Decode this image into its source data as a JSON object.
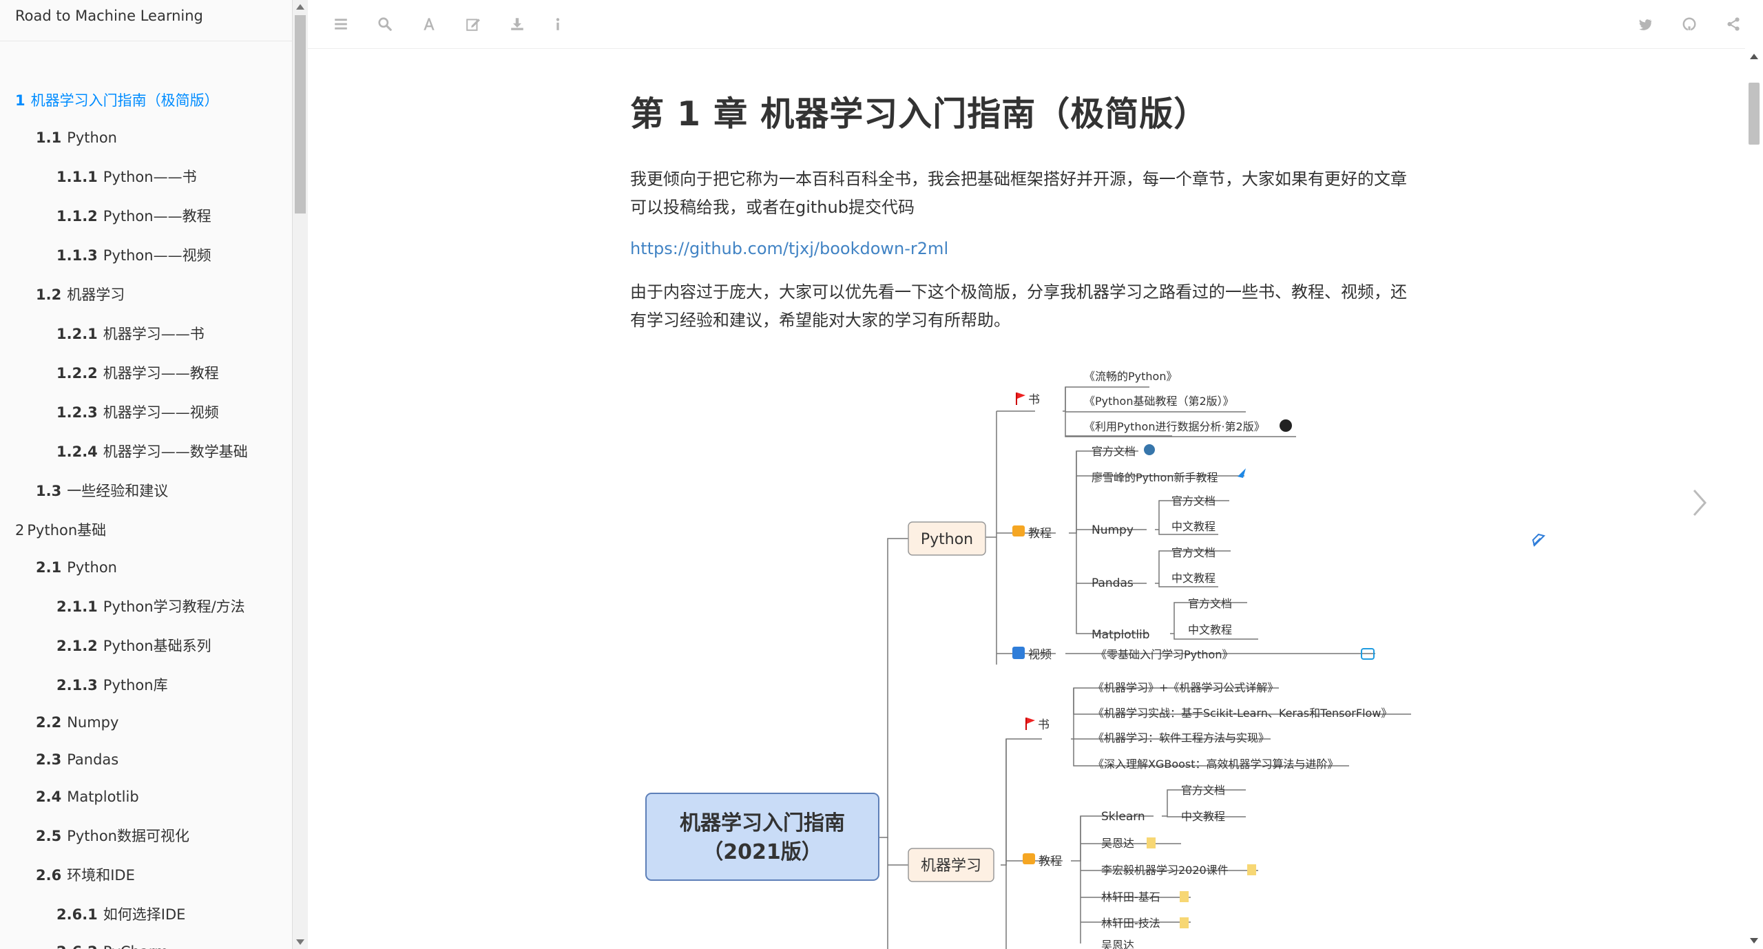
{
  "sidebar": {
    "title": "Road to Machine Learning",
    "items": [
      {
        "num": "1",
        "label": "机器学习入门指南（极简版）",
        "active": true
      },
      {
        "num": "1.1",
        "label": "Python"
      },
      {
        "num": "1.1.1",
        "label": "Python——书"
      },
      {
        "num": "1.1.2",
        "label": "Python——教程"
      },
      {
        "num": "1.1.3",
        "label": "Python——视频"
      },
      {
        "num": "1.2",
        "label": "机器学习"
      },
      {
        "num": "1.2.1",
        "label": "机器学习——书"
      },
      {
        "num": "1.2.2",
        "label": "机器学习——教程"
      },
      {
        "num": "1.2.3",
        "label": "机器学习——视频"
      },
      {
        "num": "1.2.4",
        "label": "机器学习——数学基础"
      },
      {
        "num": "1.3",
        "label": "一些经验和建议"
      },
      {
        "num": "2",
        "label": "Python基础"
      },
      {
        "num": "2.1",
        "label": "Python"
      },
      {
        "num": "2.1.1",
        "label": "Python学习教程/方法"
      },
      {
        "num": "2.1.2",
        "label": "Python基础系列"
      },
      {
        "num": "2.1.3",
        "label": "Python库"
      },
      {
        "num": "2.2",
        "label": "Numpy"
      },
      {
        "num": "2.3",
        "label": "Pandas"
      },
      {
        "num": "2.4",
        "label": "Matplotlib"
      },
      {
        "num": "2.5",
        "label": "Python数据可视化"
      },
      {
        "num": "2.6",
        "label": "环境和IDE"
      },
      {
        "num": "2.6.1",
        "label": "如何选择IDE"
      },
      {
        "num": "2.6.2",
        "label": "PyCharm"
      }
    ]
  },
  "toolbar": {
    "left_icons": [
      "menu-icon",
      "search-icon",
      "font-icon",
      "edit-icon",
      "download-icon",
      "info-icon"
    ],
    "right_icons": [
      "twitter-icon",
      "github-icon",
      "share-icon"
    ],
    "icon_color": "#b5b5b5"
  },
  "content": {
    "chapter_title": "第 1 章   机器学习入门指南（极简版）",
    "para1": "我更倾向于把它称为一本百科百科全书，我会把基础框架搭好并开源，每一个章节，大家如果有更好的文章可以投稿给我，或者在github提交代码",
    "link": "https://github.com/tjxj/bookdown-r2ml",
    "para2": "由于内容过于庞大，大家可以优先看一下这个极简版，分享我机器学习之路看过的一些书、教程、视频，还有学习经验和建议，希望能对大家的学习有所帮助。",
    "link_color": "#4183c4",
    "active_color": "#008cff"
  },
  "mindmap": {
    "root_line1": "机器学习入门指南",
    "root_line2": "（2021版）",
    "python_node": "Python",
    "ml_node": "机器学习",
    "book": "书",
    "tutorial": "教程",
    "video": "视频",
    "py_books": [
      "《流畅的Python》",
      "《Python基础教程（第2版）》",
      "《利用Python进行数据分析·第2版》"
    ],
    "py_official": "官方文档",
    "py_liao": "廖雪峰的Python新手教程",
    "numpy": "Numpy",
    "pandas": "Pandas",
    "matplotlib": "Matplotlib",
    "official_doc": "官方文档",
    "cn_tutorial": "中文教程",
    "py_video": "《零基础入门学习Python》",
    "ml_books": [
      "《机器学习》+《机器学习公式详解》",
      "《机器学习实战：基于Scikit-Learn、Keras和TensorFlow》",
      "《机器学习：软件工程方法与实现》",
      "《深入理解XGBoost：高效机器学习算法与进阶》"
    ],
    "sklearn": "Sklearn",
    "ml_tut": [
      "吴恩达",
      "李宏毅机器学习2020课件",
      "林轩田-基石",
      "林轩田-技法"
    ],
    "ml_video_first": "吴恩达",
    "root_fill": "#c9dcf7",
    "node_fill": "#fdf0e3"
  }
}
